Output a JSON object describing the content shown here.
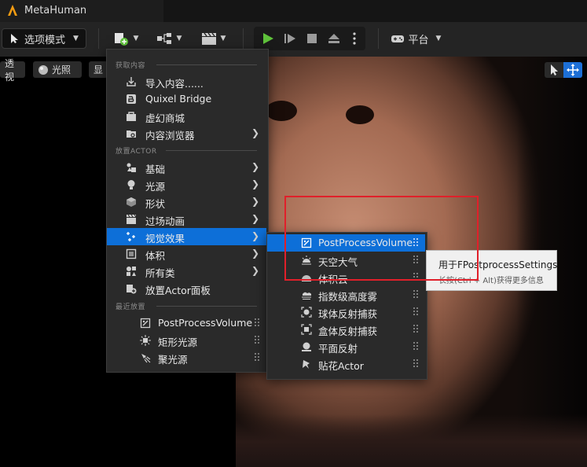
{
  "window": {
    "title": "MetaHuman"
  },
  "toolbar": {
    "modes_label": "选项模式",
    "platforms_label": "平台"
  },
  "viewport": {
    "perspective_label": "透视",
    "lit_label": "光照",
    "show_label": "显"
  },
  "main_menu": {
    "section_get_content": "获取内容",
    "section_place_actor": "放置ACTOR",
    "section_recent": "最近放置",
    "items": [
      {
        "label": "导入内容......",
        "icon": "import-icon",
        "submenu": false
      },
      {
        "label": "Quixel Bridge",
        "icon": "bridge-icon",
        "submenu": false
      },
      {
        "label": "虚幻商城",
        "icon": "marketplace-icon",
        "submenu": false
      },
      {
        "label": "内容浏览器",
        "icon": "content-browser-icon",
        "submenu": true
      },
      {
        "label": "基础",
        "icon": "basic-icon",
        "submenu": true
      },
      {
        "label": "光源",
        "icon": "light-icon",
        "submenu": true
      },
      {
        "label": "形状",
        "icon": "shape-icon",
        "submenu": true
      },
      {
        "label": "过场动画",
        "icon": "cinematic-icon",
        "submenu": true
      },
      {
        "label": "视觉效果",
        "icon": "visual-effects-icon",
        "submenu": true,
        "highlighted": true
      },
      {
        "label": "体积",
        "icon": "volume-icon",
        "submenu": true
      },
      {
        "label": "所有类",
        "icon": "all-classes-icon",
        "submenu": true
      },
      {
        "label": "放置Actor面板",
        "icon": "place-actor-panel-icon",
        "submenu": false
      }
    ],
    "recent": [
      {
        "label": "PostProcessVolume",
        "icon": "postprocess-icon"
      },
      {
        "label": "矩形光源",
        "icon": "rect-light-icon"
      },
      {
        "label": "聚光源",
        "icon": "spot-light-icon"
      }
    ]
  },
  "sub_menu": {
    "items": [
      {
        "label": "PostProcessVolume",
        "icon": "postprocess-icon",
        "highlighted": true
      },
      {
        "label": "天空大气",
        "icon": "sky-atmosphere-icon"
      },
      {
        "label": "体积云",
        "icon": "volumetric-cloud-icon"
      },
      {
        "label": "指数级高度雾",
        "icon": "height-fog-icon"
      },
      {
        "label": "球体反射捕获",
        "icon": "sphere-reflection-icon"
      },
      {
        "label": "盒体反射捕获",
        "icon": "box-reflection-icon"
      },
      {
        "label": "平面反射",
        "icon": "planar-reflection-icon"
      },
      {
        "label": "贴花Actor",
        "icon": "decal-icon"
      }
    ]
  },
  "tooltip": {
    "title": "用于FPostprocessSettings",
    "hint": "长按(Ctrl + Alt)获得更多信息"
  },
  "colors": {
    "highlight": "#0d6fd8",
    "play": "#5fc23b",
    "annotation": "#e0202a"
  }
}
